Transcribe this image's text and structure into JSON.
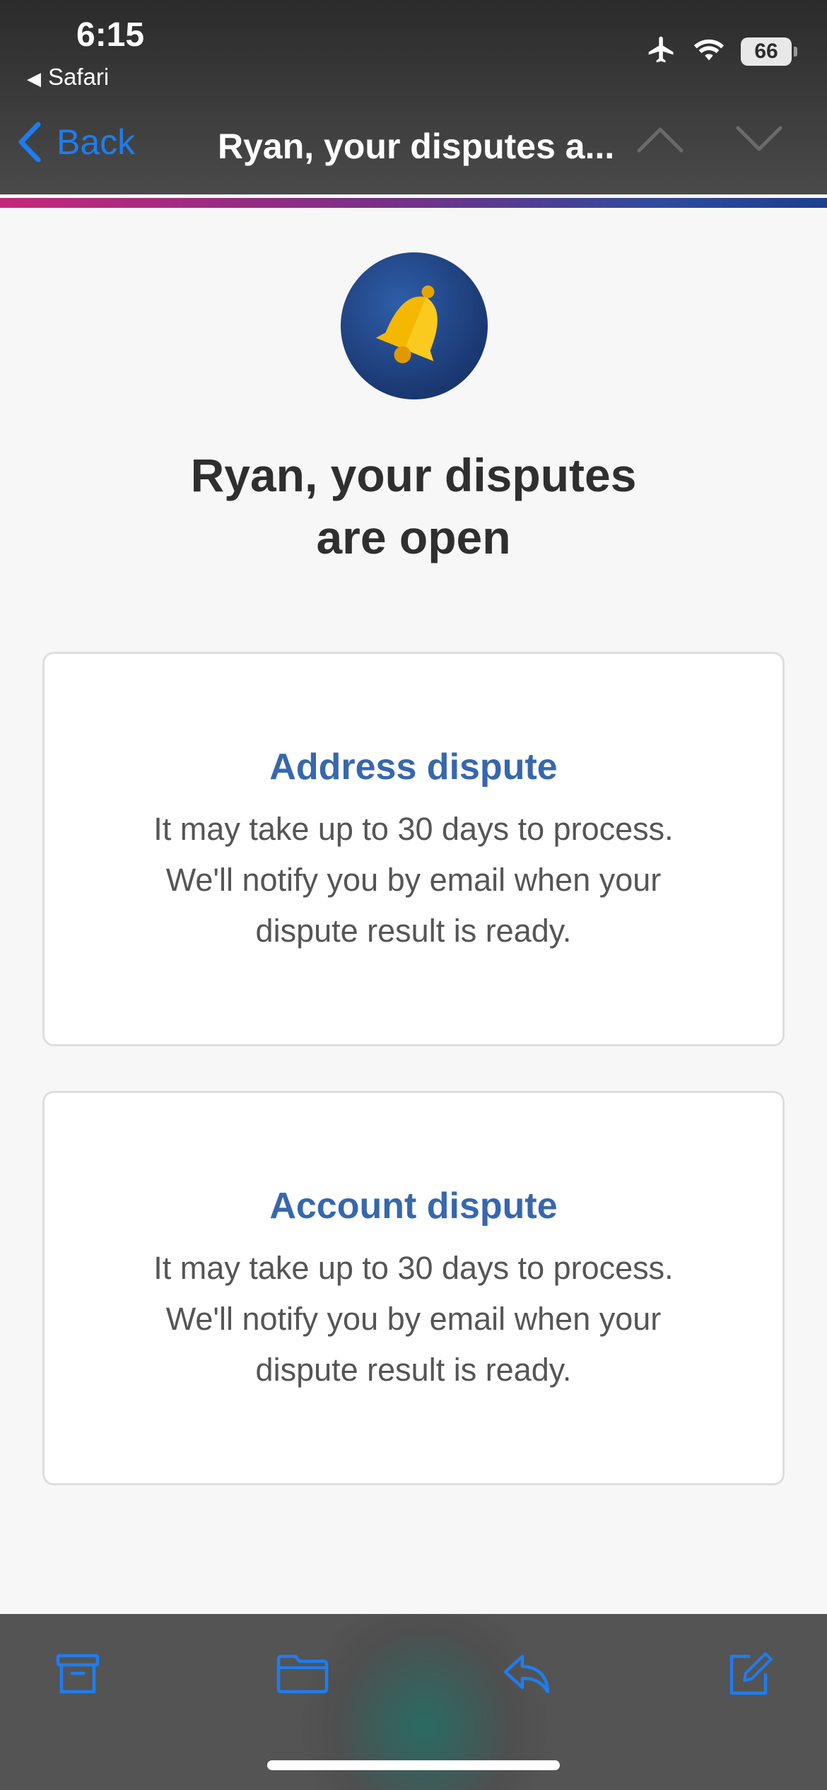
{
  "status_bar": {
    "time": "6:15",
    "back_app": "Safari",
    "battery": "66",
    "icons": [
      "airplane-icon",
      "wifi-icon",
      "battery-icon"
    ]
  },
  "nav": {
    "back_label": "Back",
    "title": "Ryan, your disputes a...",
    "icons": [
      "chevron-up-icon",
      "chevron-down-icon"
    ]
  },
  "email": {
    "headline_line1": "Ryan, your disputes",
    "headline_line2": "are open",
    "cards": [
      {
        "title": "Address dispute",
        "line1": "It may take up to 30 days to process.",
        "line2": "We'll notify you by email when your",
        "line3": "dispute result is ready."
      },
      {
        "title": "Account dispute",
        "line1": "It may take up to 30 days to process.",
        "line2": "We'll notify you by email when your",
        "line3": "dispute result is ready."
      }
    ]
  },
  "toolbar": {
    "icons": [
      "archive-icon",
      "folder-icon",
      "reply-icon",
      "compose-icon"
    ]
  },
  "colors": {
    "accent": "#1e7df0",
    "card_title": "#3767ad",
    "stripe_start": "#c5287a",
    "stripe_end": "#1e3f8e",
    "bell": "#f5b800"
  }
}
